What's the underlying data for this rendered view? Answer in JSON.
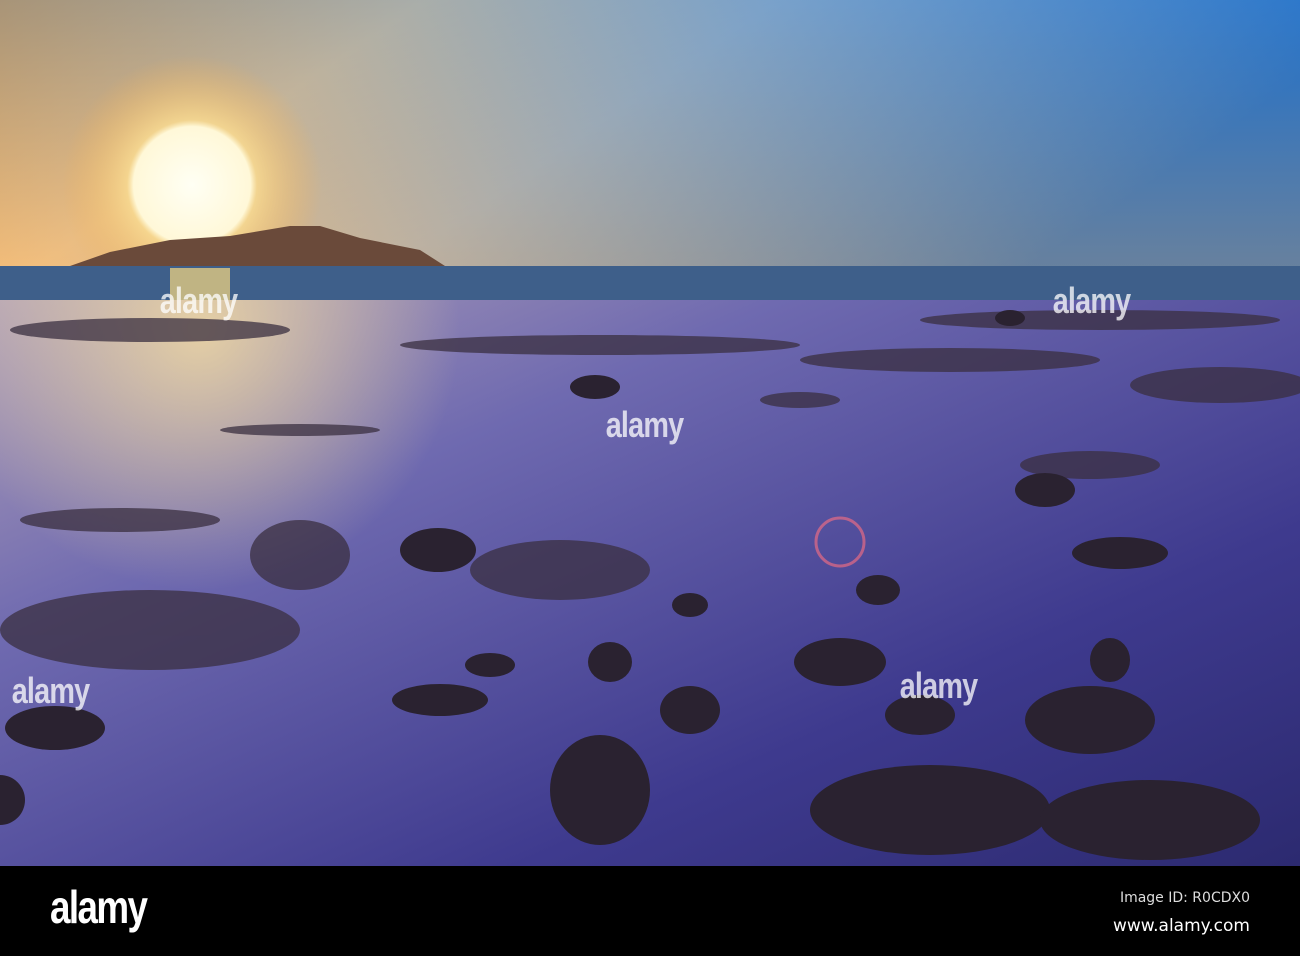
{
  "watermark": {
    "text": "alamy"
  },
  "footer": {
    "logo": "alamy",
    "image_id": "Image ID: R0CDX0",
    "site": "www.alamy.com"
  }
}
